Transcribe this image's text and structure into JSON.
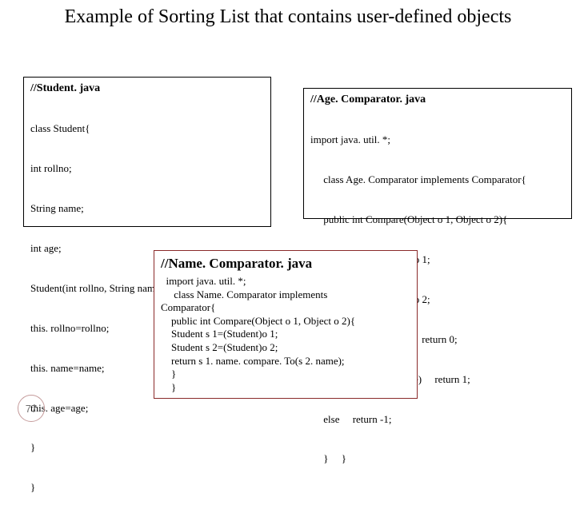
{
  "title": "Example of Sorting List that contains user-defined objects",
  "box1": {
    "heading": "//Student. java",
    "lines": [
      "class Student{",
      "int rollno;",
      "String name;",
      "int age;",
      "Student(int rollno, String name, int age){",
      "this. rollno=rollno;",
      "this. name=name;",
      "this. age=age;",
      "}",
      "}"
    ]
  },
  "box2": {
    "heading": "//Age. Comparator. java",
    "lines": [
      "import java. util. *;",
      "     class Age. Comparator implements Comparator{",
      "     public int Compare(Object o 1, Object o 2){",
      "     Student s 1=(Student)o 1;",
      "     Student s 2=(Student)o 2;",
      "     if(s1. age==s 2. age)     return 0;",
      "     else if(s1. age>s 2. age)     return 1;",
      "     else     return -1;",
      "     }     }"
    ]
  },
  "box3": {
    "heading": "//Name. Comparator. java",
    "lines": [
      "  import java. util. *;",
      "     class Name. Comparator implements",
      "Comparator{",
      "    public int Compare(Object o 1, Object o 2){",
      "    Student s 1=(Student)o 1;",
      "    Student s 2=(Student)o 2;",
      "",
      "    return s 1. name. compare. To(s 2. name);",
      "    }",
      "    }"
    ]
  },
  "pageNumber": "77"
}
